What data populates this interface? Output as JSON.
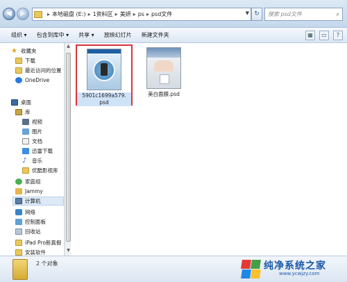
{
  "address": {
    "crumbs": [
      "本地磁盘 (E:)",
      "1资料区",
      "美妍",
      "ps",
      "psd文件"
    ],
    "search_placeholder": "搜索 psd文件"
  },
  "toolbar": {
    "items": [
      "组织 ▾",
      "包含到库中 ▾",
      "共享 ▾",
      "放映幻灯片",
      "新建文件夹"
    ]
  },
  "navpane": {
    "favorites": "收藏夹",
    "downloads": "下载",
    "recent": "最近访问的位置",
    "onedrive": "OneDrive",
    "desktop": "桌面",
    "library": "库",
    "videos": "视频",
    "pictures": "图片",
    "documents": "文档",
    "xunlei": "迅雷下载",
    "music": "音乐",
    "youku": "优酷影视库",
    "homegroup": "家庭组",
    "user": "Jammy",
    "computer": "计算机",
    "network": "网络",
    "control_panel": "控制面板",
    "recycle_bin": "回收站",
    "ipad": "iPad Pro新真假",
    "installed": "安装软件"
  },
  "files": [
    {
      "name_line1": "5901c1699a579.",
      "name_line2": "psd",
      "selected": true
    },
    {
      "name_line1": "美白面膜.psd",
      "name_line2": "",
      "selected": false
    }
  ],
  "status": {
    "count_text": "2 个对象"
  },
  "watermark": {
    "title": "纯净系统之家",
    "url": "www.ycwjzy.com",
    "colors": [
      "#e53935",
      "#43a047",
      "#1e88e5",
      "#fbc02d"
    ]
  }
}
